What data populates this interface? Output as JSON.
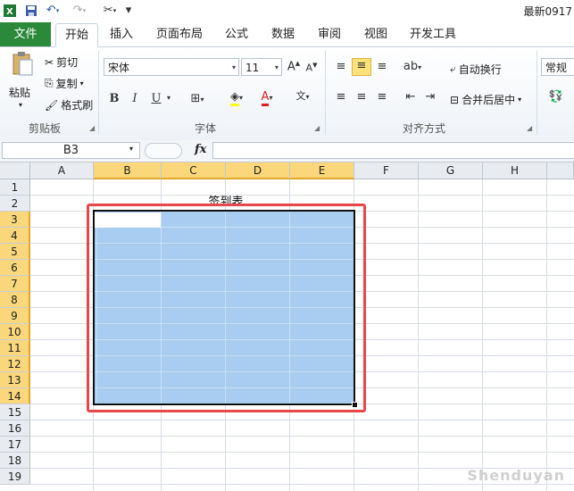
{
  "window": {
    "title": "最新0917"
  },
  "qat": {
    "customize_label": "▾"
  },
  "tabs": [
    "文件",
    "开始",
    "插入",
    "页面布局",
    "公式",
    "数据",
    "审阅",
    "视图",
    "开发工具"
  ],
  "clipboard": {
    "paste": "粘贴",
    "cut": "剪切",
    "copy": "复制",
    "format_painter": "格式刷",
    "group": "剪贴板"
  },
  "font": {
    "name": "宋体",
    "size": "11",
    "bold": "B",
    "italic": "I",
    "underline": "U",
    "group": "字体"
  },
  "alignment": {
    "wrap": "自动换行",
    "merge": "合并后居中",
    "group": "对齐方式"
  },
  "number": {
    "format": "常规"
  },
  "formula_bar": {
    "name_box": "B3",
    "fx": "fx",
    "content": ""
  },
  "columns": [
    "A",
    "B",
    "C",
    "D",
    "E",
    "F",
    "G",
    "H"
  ],
  "rows": [
    "1",
    "2",
    "3",
    "4",
    "5",
    "6",
    "7",
    "8",
    "9",
    "10",
    "11",
    "12",
    "13",
    "14",
    "15",
    "16",
    "17",
    "18",
    "19"
  ],
  "cells": {
    "B2_title": "签到表"
  },
  "selection": {
    "range": "B3:E14",
    "active_cell": "B3"
  },
  "colors": {
    "file_tab": "#2a8a3a",
    "selection": "#a9cdf0",
    "highlight_box": "#e8464a",
    "header_selected": "#f9d77a"
  },
  "watermark": "Shenduyan"
}
